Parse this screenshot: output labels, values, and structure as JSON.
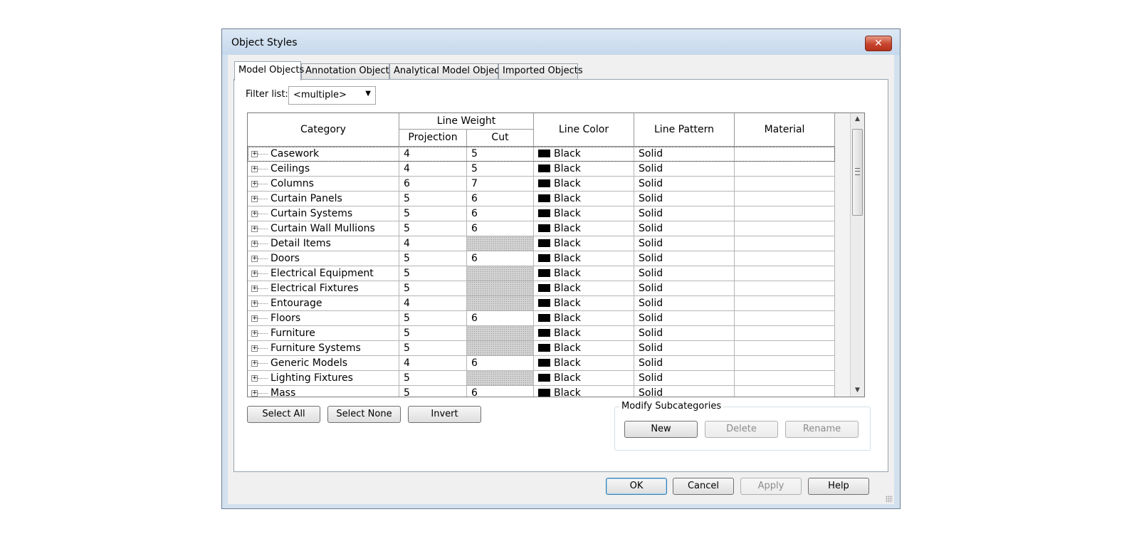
{
  "window": {
    "title": "Object Styles"
  },
  "tabs": [
    {
      "label": "Model Objects",
      "active": true
    },
    {
      "label": "Annotation Objects",
      "active": false
    },
    {
      "label": "Analytical Model Objects",
      "active": false
    },
    {
      "label": "Imported Objects",
      "active": false
    }
  ],
  "filter": {
    "label": "Filter list:",
    "value": "<multiple>"
  },
  "table": {
    "headers": {
      "category": "Category",
      "line_weight": "Line Weight",
      "projection": "Projection",
      "cut": "Cut",
      "line_color": "Line Color",
      "line_pattern": "Line Pattern",
      "material": "Material"
    },
    "rows": [
      {
        "category": "Casework",
        "projection": "4",
        "cut": "5",
        "color": "Black",
        "pattern": "Solid",
        "material": ""
      },
      {
        "category": "Ceilings",
        "projection": "4",
        "cut": "5",
        "color": "Black",
        "pattern": "Solid",
        "material": ""
      },
      {
        "category": "Columns",
        "projection": "6",
        "cut": "7",
        "color": "Black",
        "pattern": "Solid",
        "material": ""
      },
      {
        "category": "Curtain Panels",
        "projection": "5",
        "cut": "6",
        "color": "Black",
        "pattern": "Solid",
        "material": ""
      },
      {
        "category": "Curtain Systems",
        "projection": "5",
        "cut": "6",
        "color": "Black",
        "pattern": "Solid",
        "material": ""
      },
      {
        "category": "Curtain Wall Mullions",
        "projection": "5",
        "cut": "6",
        "color": "Black",
        "pattern": "Solid",
        "material": ""
      },
      {
        "category": "Detail Items",
        "projection": "4",
        "cut": "",
        "color": "Black",
        "pattern": "Solid",
        "material": ""
      },
      {
        "category": "Doors",
        "projection": "5",
        "cut": "6",
        "color": "Black",
        "pattern": "Solid",
        "material": ""
      },
      {
        "category": "Electrical Equipment",
        "projection": "5",
        "cut": "",
        "color": "Black",
        "pattern": "Solid",
        "material": ""
      },
      {
        "category": "Electrical Fixtures",
        "projection": "5",
        "cut": "",
        "color": "Black",
        "pattern": "Solid",
        "material": ""
      },
      {
        "category": "Entourage",
        "projection": "4",
        "cut": "",
        "color": "Black",
        "pattern": "Solid",
        "material": ""
      },
      {
        "category": "Floors",
        "projection": "5",
        "cut": "6",
        "color": "Black",
        "pattern": "Solid",
        "material": ""
      },
      {
        "category": "Furniture",
        "projection": "5",
        "cut": "",
        "color": "Black",
        "pattern": "Solid",
        "material": ""
      },
      {
        "category": "Furniture Systems",
        "projection": "5",
        "cut": "",
        "color": "Black",
        "pattern": "Solid",
        "material": ""
      },
      {
        "category": "Generic Models",
        "projection": "4",
        "cut": "6",
        "color": "Black",
        "pattern": "Solid",
        "material": ""
      },
      {
        "category": "Lighting Fixtures",
        "projection": "5",
        "cut": "",
        "color": "Black",
        "pattern": "Solid",
        "material": ""
      },
      {
        "category": "Mass",
        "projection": "5",
        "cut": "6",
        "color": "Black",
        "pattern": "Solid",
        "material": ""
      }
    ],
    "swatch_color": "#000000",
    "disabled_cut_color": "#d2d2d2"
  },
  "selection_buttons": {
    "select_all": "Select All",
    "select_none": "Select None",
    "invert": "Invert"
  },
  "modify_subcategories": {
    "label": "Modify Subcategories",
    "new": "New",
    "delete": "Delete",
    "rename": "Rename"
  },
  "footer": {
    "ok": "OK",
    "cancel": "Cancel",
    "apply": "Apply",
    "help": "Help"
  },
  "icons": {
    "close": "close-icon",
    "expand": "plus-box-icon",
    "dropdown": "chevron-down-icon"
  },
  "colors": {
    "title_bar": "#c5d8ec",
    "close_button": "#c9442c",
    "default_button_border": "#3c7fb1"
  }
}
